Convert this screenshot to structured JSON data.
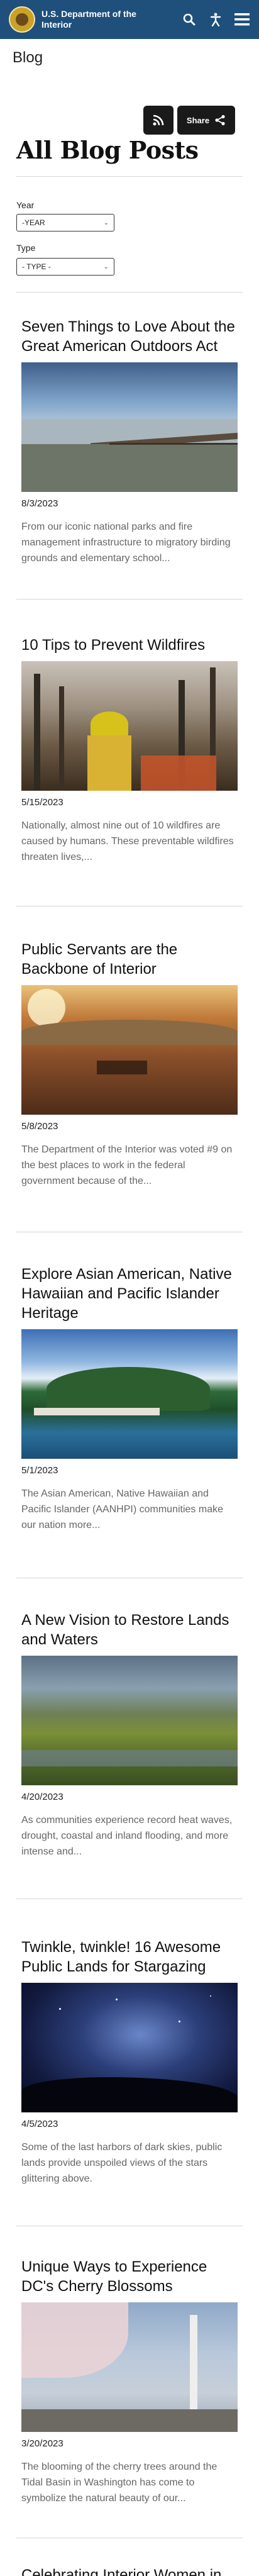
{
  "header": {
    "site_name": "U.S. Department of the Interior",
    "icons": [
      "search-icon",
      "accessibility-icon",
      "menu-icon"
    ],
    "background_color": "#1f4f7b"
  },
  "page_label": "Blog",
  "share": {
    "rss_icon": "rss-icon",
    "share_label": "Share",
    "share_icon": "share-icon"
  },
  "page_title": "All Blog Posts",
  "filters": {
    "year": {
      "label": "Year",
      "value": "-YEAR"
    },
    "type": {
      "label": "Type",
      "value": "- TYPE -"
    }
  },
  "posts": [
    {
      "title": "Seven Things to Love About the Great American Outdoors Act",
      "date": "8/3/2023",
      "summary": "From our iconic national parks and fire management infrastructure to migratory birding grounds and elementary school..."
    },
    {
      "title": "10 Tips to Prevent Wildfires",
      "date": "5/15/2023",
      "summary": "Nationally, almost nine out of 10 wildfires are caused by humans. These preventable wildfires threaten lives,..."
    },
    {
      "title": "Public Servants are the Backbone of Interior",
      "date": "5/8/2023",
      "summary": "The Department of the Interior was voted #9 on the best places to work in the federal government because of the..."
    },
    {
      "title": "Explore Asian American, Native Hawaiian and Pacific Islander Heritage",
      "date": "5/1/2023",
      "summary": "The Asian American, Native Hawaiian and Pacific Islander (AANHPI) communities make our nation more..."
    },
    {
      "title": "A New Vision to Restore Lands and Waters",
      "date": "4/20/2023",
      "summary": "As communities experience record heat waves, drought, coastal and inland flooding, and more intense and..."
    },
    {
      "title": "Twinkle, twinkle! 16 Awesome Public Lands for Stargazing",
      "date": "4/5/2023",
      "summary": "Some of the last harbors of dark skies, public lands provide unspoiled views of the stars glittering above."
    },
    {
      "title": "Unique Ways to Experience DC's Cherry Blossoms",
      "date": "3/20/2023",
      "summary": "The blooming of the cherry trees around the Tidal Basin in Washington has come to symbolize the natural beauty of our..."
    },
    {
      "title": "Celebrating Interior Women in"
    }
  ]
}
